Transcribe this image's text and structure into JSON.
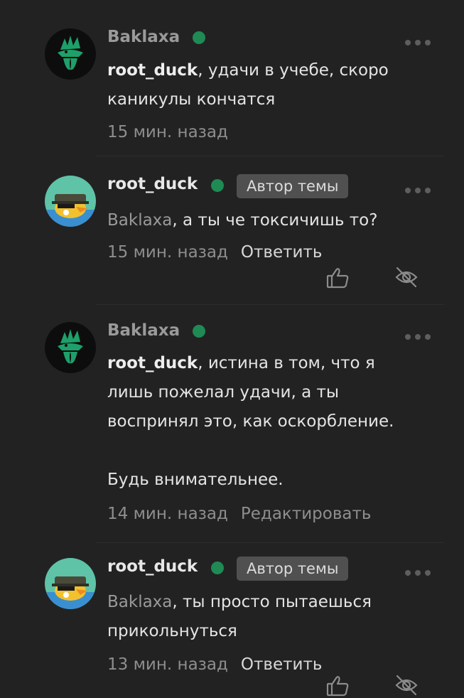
{
  "comments": [
    {
      "author": "Baklaxa",
      "mention": "root_duck",
      "lines": [
        ", удачи в учебе, скоро",
        "каникулы кончатся"
      ],
      "time": "15 мин. назад"
    },
    {
      "author": "root_duck",
      "badge": "Автор темы",
      "mention": "Baklaxa",
      "lines": [
        ", а ты че токсичишь то?"
      ],
      "time": "15 мин. назад",
      "action": "Ответить"
    },
    {
      "author": "Baklaxa",
      "mention": "root_duck",
      "lines": [
        ", истина в том, что я",
        "лишь пожелал удачи, а ты",
        "воспринял это, как оскорбление.",
        "",
        "Будь внимательнее."
      ],
      "time": "14 мин. назад",
      "action": "Редактировать"
    },
    {
      "author": "root_duck",
      "badge": "Автор темы",
      "mention": "Baklaxa",
      "lines": [
        ", ты просто пытаешься",
        "прикольнуться"
      ],
      "time": "13 мин. назад",
      "action": "Ответить"
    }
  ],
  "icons": {
    "like": "thumbs-up-icon",
    "hide": "eye-off-icon",
    "more": "more-dots-icon",
    "online": "online-status-dot"
  },
  "colors": {
    "background": "#222222",
    "online": "#1f8a53",
    "badge_bg": "#505050",
    "avatar_dark": "#0d0d0d",
    "avatar_green": "#1ea06a",
    "avatar_teal": "#5fc3a8"
  }
}
